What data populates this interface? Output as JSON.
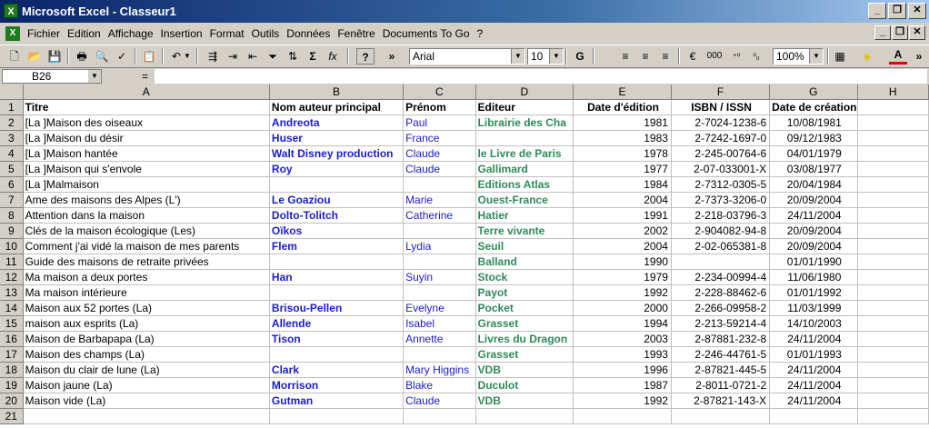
{
  "window": {
    "title": "Microsoft Excel - Classeur1",
    "app_icon": "X",
    "minimize": "_",
    "restore": "❐",
    "close": "✕"
  },
  "menu": {
    "items": [
      "Fichier",
      "Edition",
      "Affichage",
      "Insertion",
      "Format",
      "Outils",
      "Données",
      "Fenêtre",
      "Documents To Go",
      "?"
    ],
    "mdi": {
      "minimize": "_",
      "restore": "❐",
      "close": "✕"
    }
  },
  "toolbar": {
    "font_name": "Arial",
    "font_size": "10",
    "zoom": "100%",
    "bold": "G",
    "underline_letter": "A",
    "sigma": "Σ",
    "fx": "fx",
    "help": "?",
    "more": "»",
    "currency": "000"
  },
  "formula_bar": {
    "cell_ref": "B26",
    "equals": "=",
    "value": ""
  },
  "columns": [
    "A",
    "B",
    "C",
    "D",
    "E",
    "F",
    "G",
    "H"
  ],
  "rows": [
    {
      "n": "1",
      "a": "Titre",
      "b": "Nom auteur principal",
      "c": "Prénom",
      "d": "Editeur",
      "e": "Date d'édition",
      "f": "ISBN / ISSN",
      "g": "Date de création"
    },
    {
      "n": "2",
      "a": "[La ]Maison des oiseaux",
      "b": "Andreota",
      "c": "Paul",
      "d": "Librairie des Cha",
      "e": "1981",
      "f": "2-7024-1238-6",
      "g": "10/08/1981"
    },
    {
      "n": "3",
      "a": "[La ]Maison du désir",
      "b": "Huser",
      "c": "France",
      "d": "",
      "e": "1983",
      "f": "2-7242-1697-0",
      "g": "09/12/1983"
    },
    {
      "n": "4",
      "a": "[La ]Maison hantée",
      "b": "Walt Disney production",
      "c": "Claude",
      "d": "le Livre de Paris",
      "e": "1978",
      "f": "2-245-00764-6",
      "g": "04/01/1979"
    },
    {
      "n": "5",
      "a": "[La ]Maison qui s'envole",
      "b": "Roy",
      "c": "Claude",
      "d": "Gallimard",
      "e": "1977",
      "f": "2-07-033001-X",
      "g": "03/08/1977"
    },
    {
      "n": "6",
      "a": "[La ]Malmaison",
      "b": "",
      "c": "",
      "d": "Editions Atlas",
      "e": "1984",
      "f": "2-7312-0305-5",
      "g": "20/04/1984"
    },
    {
      "n": "7",
      "a": "Ame des maisons des Alpes (L')",
      "b": "Le Goaziou",
      "c": "Marie",
      "d": "Ouest-France",
      "e": "2004",
      "f": "2-7373-3206-0",
      "g": "20/09/2004"
    },
    {
      "n": "8",
      "a": "Attention dans la maison",
      "b": "Dolto-Tolitch",
      "c": "Catherine",
      "d": "Hatier",
      "e": "1991",
      "f": "2-218-03796-3",
      "g": "24/11/2004"
    },
    {
      "n": "9",
      "a": "Clés de la maison écologique (Les)",
      "b": "Oïkos",
      "c": "",
      "d": "Terre vivante",
      "e": "2002",
      "f": "2-904082-94-8",
      "g": "20/09/2004"
    },
    {
      "n": "10",
      "a": "Comment j'ai vidé la maison de mes parents",
      "b": "Flem",
      "c": "Lydia",
      "d": "Seuil",
      "e": "2004",
      "f": "2-02-065381-8",
      "g": "20/09/2004"
    },
    {
      "n": "11",
      "a": "Guide des maisons de retraite privées",
      "b": "",
      "c": "",
      "d": "Balland",
      "e": "1990",
      "f": "",
      "g": "01/01/1990"
    },
    {
      "n": "12",
      "a": "Ma maison a deux portes",
      "b": "Han",
      "c": "Suyin",
      "d": "Stock",
      "e": "1979",
      "f": "2-234-00994-4",
      "g": "11/06/1980"
    },
    {
      "n": "13",
      "a": "Ma maison intérieure",
      "b": "",
      "c": "",
      "d": "Payot",
      "e": "1992",
      "f": "2-228-88462-6",
      "g": "01/01/1992"
    },
    {
      "n": "14",
      "a": "Maison aux 52 portes (La)",
      "b": "Brisou-Pellen",
      "c": "Evelyne",
      "d": "Pocket",
      "e": "2000",
      "f": "2-266-09958-2",
      "g": "11/03/1999"
    },
    {
      "n": "15",
      "a": "maison aux esprits (La)",
      "b": "Allende",
      "c": "Isabel",
      "d": "Grasset",
      "e": "1994",
      "f": "2-213-59214-4",
      "g": "14/10/2003"
    },
    {
      "n": "16",
      "a": "Maison de Barbapapa (La)",
      "b": "Tison",
      "c": "Annette",
      "d": "Livres du Dragon",
      "e": "2003",
      "f": "2-87881-232-8",
      "g": "24/11/2004"
    },
    {
      "n": "17",
      "a": "Maison des champs (La)",
      "b": "",
      "c": "",
      "d": "Grasset",
      "e": "1993",
      "f": "2-246-44761-5",
      "g": "01/01/1993"
    },
    {
      "n": "18",
      "a": "Maison du clair de lune (La)",
      "b": "Clark",
      "c": "Mary Higgins",
      "d": "VDB",
      "e": "1996",
      "f": "2-87821-445-5",
      "g": "24/11/2004"
    },
    {
      "n": "19",
      "a": "Maison jaune (La)",
      "b": "Morrison",
      "c": "Blake",
      "d": "Duculot",
      "e": "1987",
      "f": "2-8011-0721-2",
      "g": "24/11/2004"
    },
    {
      "n": "20",
      "a": "Maison vide (La)",
      "b": "Gutman",
      "c": "Claude",
      "d": "VDB",
      "e": "1992",
      "f": "2-87821-143-X",
      "g": "24/11/2004"
    },
    {
      "n": "21",
      "a": "",
      "b": "",
      "c": "",
      "d": "",
      "e": "",
      "f": "",
      "g": ""
    }
  ]
}
